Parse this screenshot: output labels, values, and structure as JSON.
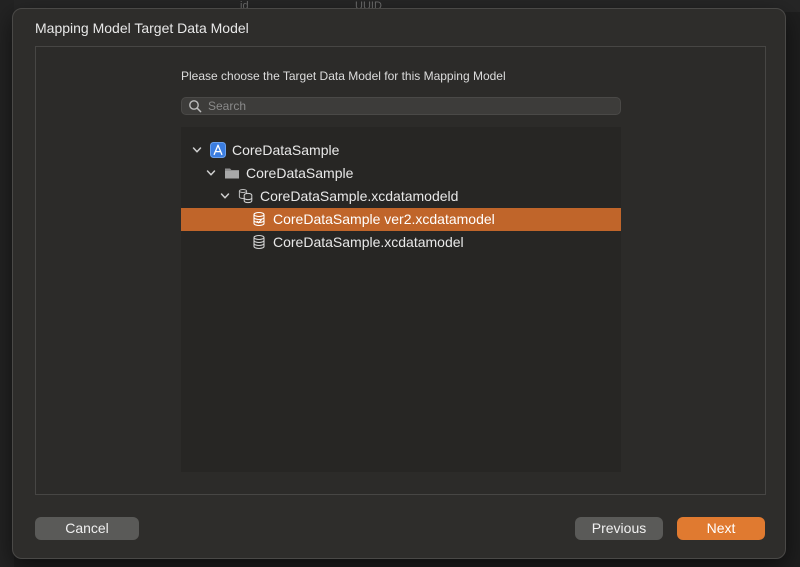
{
  "background": {
    "columns": [
      "id",
      "UUID"
    ]
  },
  "sheet": {
    "title": "Mapping Model Target Data Model",
    "prompt": "Please choose the Target Data Model for this Mapping Model"
  },
  "search": {
    "placeholder": "Search",
    "value": ""
  },
  "tree": {
    "items": [
      {
        "label": "CoreDataSample",
        "icon": "app-project-icon",
        "level": 0,
        "expanded": true,
        "selected": false
      },
      {
        "label": "CoreDataSample",
        "icon": "folder-icon",
        "level": 1,
        "expanded": true,
        "selected": false
      },
      {
        "label": "CoreDataSample.xcdatamodeld",
        "icon": "versioned-data-model-icon",
        "level": 2,
        "expanded": true,
        "selected": false
      },
      {
        "label": "CoreDataSample ver2.xcdatamodel",
        "icon": "data-model-icon",
        "level": 3,
        "selected": true
      },
      {
        "label": "CoreDataSample.xcdatamodel",
        "icon": "data-model-icon",
        "level": 3,
        "selected": false
      }
    ]
  },
  "buttons": {
    "cancel": "Cancel",
    "previous": "Previous",
    "next": "Next"
  },
  "colors": {
    "selection": "#c0652a",
    "primary_button": "#e07a30",
    "app_icon": "#3b7de0"
  }
}
